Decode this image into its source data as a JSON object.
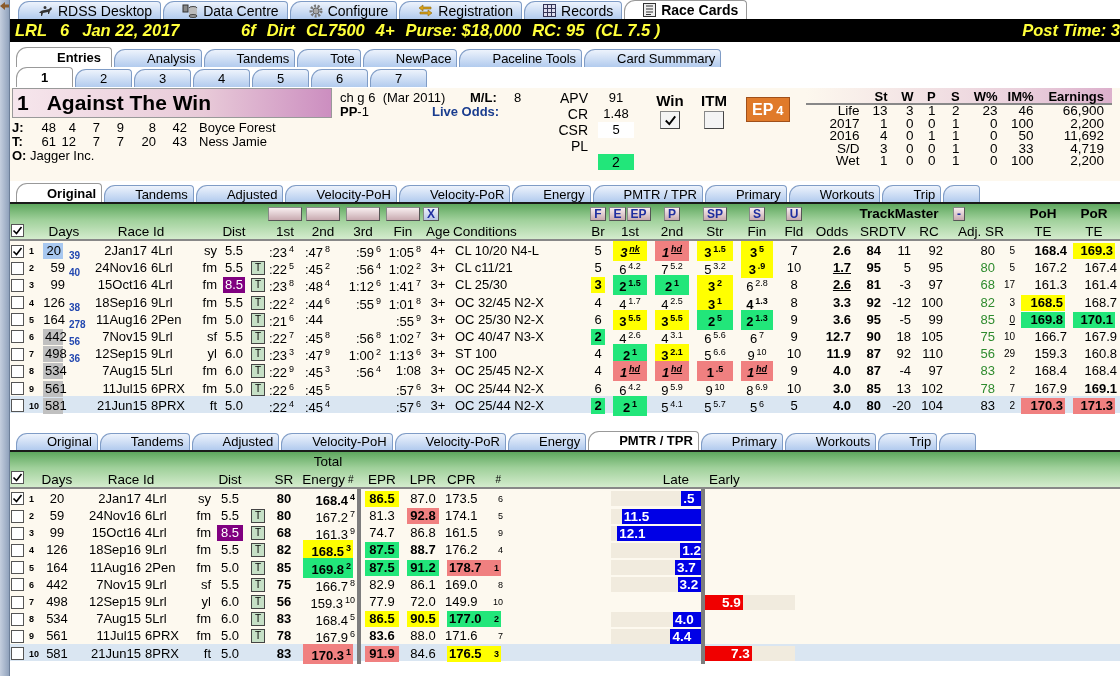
{
  "app_tabs": [
    {
      "label": "RDSS Desktop",
      "selected": false
    },
    {
      "label": "Data Centre",
      "selected": false
    },
    {
      "label": "Configure",
      "selected": false
    },
    {
      "label": "Registration",
      "selected": false
    },
    {
      "label": "Records",
      "selected": false
    },
    {
      "label": "Race Cards",
      "selected": true
    }
  ],
  "race_bar": {
    "track": "LRL",
    "race": "6",
    "date": "Jan 22, 2017",
    "details": [
      "6f",
      "Dirt",
      "CL7500",
      "4+",
      "Purse: $18,000",
      "RC: 95",
      "(CL 7.5 )"
    ],
    "post_time": "Post Time: 3"
  },
  "card_tabs": [
    {
      "label": "Entries",
      "selected": true
    },
    {
      "label": "Analysis",
      "selected": false
    },
    {
      "label": "Tandems",
      "selected": false
    },
    {
      "label": "Tote",
      "selected": false
    },
    {
      "label": "NewPace",
      "selected": false
    },
    {
      "label": "Paceline Tools",
      "selected": false
    },
    {
      "label": "Card Summmary",
      "selected": false
    }
  ],
  "horse_tabs": [
    {
      "label": "1",
      "selected": true
    },
    {
      "label": "2",
      "selected": false
    },
    {
      "label": "3",
      "selected": false
    },
    {
      "label": "4",
      "selected": false
    },
    {
      "label": "5",
      "selected": false
    },
    {
      "label": "6",
      "selected": false
    },
    {
      "label": "7",
      "selected": false
    }
  ],
  "horse": {
    "number": "1",
    "name": "Against The Win",
    "connections": [
      {
        "label": "J:",
        "stats": [
          "48",
          "4",
          "7",
          "9",
          "8",
          "42"
        ],
        "name": "Boyce Forest"
      },
      {
        "label": "T:",
        "stats": [
          "61",
          "12",
          "7",
          "7",
          "20",
          "43"
        ],
        "name": "Ness Jamie"
      },
      {
        "label": "O:",
        "name": "Jagger Inc."
      }
    ],
    "description": "ch g 6  (Mar 2011)",
    "ml_label": "M/L:",
    "ml": "8",
    "post_position": "**PP**-1",
    "live_odds_label": "Live Odds:",
    "ratings": [
      {
        "kind": "plain",
        "label": "APV",
        "value": "91"
      },
      {
        "kind": "plain",
        "label": "CR",
        "value": "1.48"
      },
      {
        "kind": "box",
        "label": "CSR",
        "value": "5"
      },
      {
        "kind": "plain",
        "label": "PL"
      }
    ],
    "pl_value": "2",
    "bets": [
      {
        "label": "Win",
        "checked": true
      },
      {
        "label": "ITM",
        "checked": false
      }
    ],
    "ep": {
      "label": "EP",
      "value": "4"
    },
    "record": {
      "columns": [
        "St",
        "W",
        "P",
        "S",
        "W%",
        "IM%",
        "Earnings"
      ],
      "rows": [
        {
          "label": "Life",
          "values": [
            "13",
            "3",
            "1",
            "2",
            "23",
            "46",
            "66,900"
          ]
        },
        {
          "label": "2017",
          "values": [
            "1",
            "0",
            "0",
            "1",
            "0",
            "100",
            "2,200"
          ]
        },
        {
          "label": "2016",
          "values": [
            "4",
            "0",
            "1",
            "1",
            "0",
            "50",
            "11,692"
          ]
        },
        {
          "label": "S/D",
          "values": [
            "3",
            "0",
            "0",
            "1",
            "0",
            "33",
            "4,719"
          ]
        },
        {
          "label": "Wet",
          "values": [
            "1",
            "0",
            "0",
            "1",
            "0",
            "100",
            "2,200"
          ]
        }
      ]
    }
  },
  "pp": {
    "tabs": [
      {
        "label": "Original",
        "selected": true
      },
      {
        "label": "Tandems",
        "selected": false
      },
      {
        "label": "Adjusted",
        "selected": false
      },
      {
        "label": "Velocity-PoH",
        "selected": false
      },
      {
        "label": "Velocity-PoR",
        "selected": false
      },
      {
        "label": "Energy",
        "selected": false
      },
      {
        "label": "PMTR / TPR",
        "selected": false
      },
      {
        "label": "Primary",
        "selected": false
      },
      {
        "label": "Workouts",
        "selected": false
      },
      {
        "label": "Trip",
        "selected": false
      },
      {
        "selected": false
      }
    ],
    "select_all": true,
    "clear_button": "X",
    "pace_buttons": [
      "F",
      "E",
      "EP",
      "P",
      "SP",
      "S",
      "U"
    ],
    "adj_button": "-",
    "headers": {
      "days": "Days",
      "race_id": "Race Id",
      "dist": "Dist",
      "c1": "1st",
      "c2": "2nd",
      "c3": "3rd",
      "fin": "Fin",
      "age": "Age",
      "conditions": "Conditions",
      "br": "Br",
      "pos1": "1st",
      "pos2": "2nd",
      "str": "Str",
      "pos_fin": "Fin",
      "field": "Fld",
      "odds": "Odds",
      "trackmaster": "TrackMaster",
      "srdtv": "SRDTV",
      "rc": "RC",
      "adj_sr": "Adj. SR",
      "poh": "PoH",
      "poh_te": "TE",
      "por": "PoR",
      "por_te": "TE"
    },
    "rows": [
      {
        "checked": true,
        "selected": false,
        "num": "1",
        "days": {
          "text": "20",
          "color": "#a8c8f0"
        },
        "layoff": "39",
        "date": "2Jan17",
        "track": "4Lrl",
        "surface": "sy",
        "dist": "5.5",
        "c1": {
          "text": ":23",
          "sup": "4"
        },
        "c2": {
          "text": ":47",
          "sup": "8"
        },
        "c3": {
          "text": ":59",
          "sup": "6"
        },
        "fin": {
          "text": "1:05",
          "sup": "8"
        },
        "age": "4+",
        "conditions": "CL 10/20 N4-L",
        "br": "5",
        "pos1": {
          "text": "3",
          "sup": "nk",
          "color": "#ffff00",
          "bold": true,
          "underline": true
        },
        "pos2": {
          "text": "1",
          "sup": "hd",
          "color": "#f08080",
          "bold": true,
          "underline": true
        },
        "str": {
          "text": "3",
          "sup": "1.5",
          "color": "#ffff00",
          "bold": true
        },
        "pos_fin": {
          "text": "3",
          "sup": "5",
          "color": "#ffff00",
          "bold": true
        },
        "field": "7",
        "odds": "2.6",
        "sr": "84",
        "dtv": "11",
        "rc": "92",
        "adj_sr": "80",
        "adj_rank": "5",
        "poh_te": {
          "text": "168.4",
          "bold": true
        },
        "por_te": {
          "text": "169.3",
          "color": "#ffff00",
          "bold": true
        }
      },
      {
        "checked": false,
        "selected": false,
        "num": "2",
        "days": "59",
        "layoff": "40",
        "date": "24Nov16",
        "track": "6Lrl",
        "surface": "fm",
        "dist": "5.5",
        "t_flag": "T",
        "c1": {
          "text": ":22",
          "sup": "5"
        },
        "c2": {
          "text": ":45",
          "sup": "2"
        },
        "c3": {
          "text": ":56",
          "sup": "4"
        },
        "fin": {
          "text": "1:02",
          "sup": "2"
        },
        "age": "3+",
        "conditions": "CL c11/21",
        "br": "5",
        "pos1": {
          "text": "6",
          "sup": "4.2"
        },
        "pos2": {
          "text": "7",
          "sup": "5.2"
        },
        "str": {
          "text": "5",
          "sup": "3.2"
        },
        "pos_fin": {
          "text": "3",
          "sup": ".9",
          "color": "#ffff00",
          "bold": true
        },
        "field": "10",
        "odds": {
          "text": "1.7",
          "underline": true
        },
        "sr": "95",
        "dtv": "5",
        "rc": "95",
        "adj_sr": {
          "text": "80",
          "color": "#2e8b2e"
        },
        "adj_rank": "5",
        "poh_te": "167.2",
        "por_te": "167.4"
      },
      {
        "checked": false,
        "selected": false,
        "num": "3",
        "days": "99",
        "date": "15Oct16",
        "track": "4Lrl",
        "surface": "fm",
        "dist": {
          "text": "8.5",
          "color": "#800080"
        },
        "t_flag": "T",
        "c1": {
          "text": ":23",
          "sup": "8"
        },
        "c2": {
          "text": ":48",
          "sup": "4"
        },
        "c3": {
          "text": "1:12",
          "sup": "6"
        },
        "fin": {
          "text": "1:41",
          "sup": "7"
        },
        "age": "3+",
        "conditions": "CL 25/30",
        "br": {
          "text": "3",
          "color": "#ffff00",
          "bold": true
        },
        "pos1": {
          "text": "2",
          "sup": "1.5",
          "color": "#22e67a",
          "bold": true
        },
        "pos2": {
          "text": "2",
          "sup": "1",
          "color": "#22e67a",
          "bold": true
        },
        "str": {
          "text": "3",
          "sup": "2",
          "color": "#ffff00",
          "bold": true
        },
        "pos_fin": {
          "text": "6",
          "sup": "2.8"
        },
        "field": "8",
        "odds": {
          "text": "2.6",
          "underline": true
        },
        "sr": "81",
        "dtv": "-3",
        "rc": "97",
        "adj_sr": {
          "text": "68",
          "color": "#2e8b2e"
        },
        "adj_rank": "17",
        "poh_te": "161.3",
        "por_te": "161.4"
      },
      {
        "checked": false,
        "selected": false,
        "num": "4",
        "days": "126",
        "layoff": "38",
        "date": "18Sep16",
        "track": "9Lrl",
        "surface": "fm",
        "dist": "5.5",
        "t_flag": "T",
        "c1": {
          "text": ":22",
          "sup": "2"
        },
        "c2": {
          "text": ":44",
          "sup": "6"
        },
        "c3": {
          "text": ":55",
          "sup": "9"
        },
        "fin": {
          "text": "1:01",
          "sup": "8"
        },
        "age": "3+",
        "conditions": "OC 32/45 N2-X",
        "br": "4",
        "pos1": {
          "text": "4",
          "sup": "1.7"
        },
        "pos2": {
          "text": "4",
          "sup": "2.5"
        },
        "str": {
          "text": "3",
          "sup": "1",
          "color": "#ffff00",
          "bold": true
        },
        "pos_fin": {
          "text": "4",
          "sup": "1.3",
          "bold": true
        },
        "field": "8",
        "odds": "3.3",
        "sr": "92",
        "dtv": "-12",
        "rc": "100",
        "adj_sr": {
          "text": "82",
          "color": "#2e8b2e"
        },
        "adj_rank": "3",
        "poh_te": {
          "text": "168.5",
          "color": "#ffff00",
          "bold": true
        },
        "por_te": "168.7"
      },
      {
        "checked": false,
        "selected": false,
        "num": "5",
        "days": "164",
        "layoff": "278",
        "date": "11Aug16",
        "track": "2Pen",
        "surface": "fm",
        "dist": "5.0",
        "t_flag": "T",
        "c1": {
          "text": ":21",
          "sup": "6"
        },
        "c2": ":44",
        "fin": {
          "text": ":55",
          "sup": "9"
        },
        "age": "3+",
        "conditions": "OC 25/30 N2-X",
        "br": "6",
        "pos1": {
          "text": "3",
          "sup": "5.5",
          "color": "#ffff00",
          "bold": true
        },
        "pos2": {
          "text": "3",
          "sup": "5.5",
          "color": "#ffff00",
          "bold": true
        },
        "str": {
          "text": "2",
          "sup": "5",
          "color": "#22e67a",
          "bold": true
        },
        "pos_fin": {
          "text": "2",
          "sup": "1.3",
          "color": "#22e67a",
          "bold": true
        },
        "field": "9",
        "odds": "3.6",
        "sr": "95",
        "dtv": "-5",
        "rc": "99",
        "adj_sr": {
          "text": "85",
          "color": "#2e8b2e"
        },
        "adj_rank": {
          "text": "0",
          "underline": true
        },
        "poh_te": {
          "text": "169.8",
          "color": "#22e67a",
          "bold": true
        },
        "por_te": {
          "text": "170.1",
          "color": "#22e67a",
          "bold": true
        }
      },
      {
        "checked": false,
        "selected": false,
        "num": "6",
        "days": {
          "text": "442",
          "color": "#c0c0c0"
        },
        "layoff": "56",
        "date": "7Nov15",
        "track": "9Lrl",
        "surface": "sf",
        "dist": "5.5",
        "t_flag": "T",
        "c1": {
          "text": ":22",
          "sup": "7"
        },
        "c2": {
          "text": ":45",
          "sup": "8"
        },
        "c3": {
          "text": ":56",
          "sup": "8"
        },
        "fin": {
          "text": "1:02",
          "sup": "7"
        },
        "age": "3+",
        "conditions": "OC 40/47 N3-X",
        "br": {
          "text": "2",
          "color": "#22e67a",
          "bold": true
        },
        "pos1": {
          "text": "4",
          "sup": "2.6"
        },
        "pos2": {
          "text": "4",
          "sup": "3.1"
        },
        "str": {
          "text": "6",
          "sup": "5.6"
        },
        "pos_fin": {
          "text": "6",
          "sup": "7"
        },
        "field": "9",
        "odds": "12.7",
        "sr": "90",
        "dtv": "18",
        "rc": "105",
        "adj_sr": {
          "text": "75",
          "color": "#2e8b2e"
        },
        "adj_rank": "10",
        "poh_te": "166.7",
        "por_te": "167.9"
      },
      {
        "checked": false,
        "selected": false,
        "num": "7",
        "days": {
          "text": "498",
          "color": "#c0c0c0"
        },
        "layoff": "36",
        "date": "12Sep15",
        "track": "9Lrl",
        "surface": "yl",
        "dist": "6.0",
        "t_flag": "T",
        "c1": {
          "text": ":23",
          "sup": "3"
        },
        "c2": {
          "text": ":47",
          "sup": "9"
        },
        "c3": {
          "text": "1:00",
          "sup": "2"
        },
        "fin": {
          "text": "1:13",
          "sup": "6"
        },
        "age": "3+",
        "conditions": "ST 100",
        "br": "4",
        "pos1": {
          "text": "2",
          "sup": "1",
          "color": "#22e67a",
          "bold": true
        },
        "pos2": {
          "text": "3",
          "sup": "2.1",
          "color": "#ffff00",
          "bold": true
        },
        "str": {
          "text": "5",
          "sup": "6.6"
        },
        "pos_fin": {
          "text": "9",
          "sup": "10"
        },
        "field": "10",
        "odds": "11.9",
        "sr": "87",
        "dtv": "92",
        "rc": "110",
        "adj_sr": {
          "text": "56",
          "color": "#2e8b2e"
        },
        "adj_rank": "29",
        "poh_te": "159.3",
        "por_te": "160.8"
      },
      {
        "checked": false,
        "selected": false,
        "num": "8",
        "days": {
          "text": "534",
          "color": "#c0c0c0"
        },
        "date": "7Aug15",
        "track": "5Lrl",
        "surface": "fm",
        "dist": "6.0",
        "t_flag": "T",
        "c1": {
          "text": ":22",
          "sup": "9"
        },
        "c2": {
          "text": ":45",
          "sup": "3"
        },
        "c3": {
          "text": ":56",
          "sup": "4"
        },
        "fin": "1:08",
        "age": "3+",
        "conditions": "OC 25/45 N2-X",
        "br": "4",
        "pos1": {
          "text": "1",
          "sup": "hd",
          "color": "#f08080",
          "bold": true,
          "underline": true
        },
        "pos2": {
          "text": "1",
          "sup": "hd",
          "color": "#f08080",
          "bold": true,
          "underline": true
        },
        "str": {
          "text": "1",
          "sup": ".5",
          "color": "#f08080",
          "bold": true
        },
        "pos_fin": {
          "text": "1",
          "sup": "hd",
          "color": "#f08080",
          "bold": true,
          "underline": true
        },
        "field": "9",
        "odds": "4.0",
        "sr": "87",
        "dtv": "-4",
        "rc": "97",
        "adj_sr": {
          "text": "83",
          "color": "#2e8b2e"
        },
        "adj_rank": "2",
        "poh_te": "168.4",
        "por_te": "168.4"
      },
      {
        "checked": false,
        "selected": false,
        "num": "9",
        "days": {
          "text": "561",
          "color": "#c0c0c0"
        },
        "date": "11Jul15",
        "track": "6PRX",
        "surface": "fm",
        "dist": "5.0",
        "t_flag": "T",
        "c1": {
          "text": ":22",
          "sup": "6"
        },
        "c2": {
          "text": ":45",
          "sup": "5"
        },
        "fin": {
          "text": ":57",
          "sup": "6"
        },
        "age": "3+",
        "conditions": "OC 25/44 N2-X",
        "br": "6",
        "pos1": {
          "text": "6",
          "sup": "4.2"
        },
        "pos2": {
          "text": "9",
          "sup": "5.9"
        },
        "str": {
          "text": "9",
          "sup": "10"
        },
        "pos_fin": {
          "text": "8",
          "sup": "6.9"
        },
        "field": "10",
        "odds": "3.0",
        "sr": "85",
        "dtv": "13",
        "rc": "102",
        "adj_sr": {
          "text": "78",
          "color": "#2e8b2e"
        },
        "adj_rank": "7",
        "poh_te": "167.9",
        "por_te": {
          "text": "169.1",
          "bold": true
        }
      },
      {
        "checked": false,
        "selected": true,
        "num": "10",
        "days": {
          "text": "581",
          "color": "#c0c0c0"
        },
        "date": "21Jun15",
        "track": "8PRX",
        "surface": "ft",
        "dist": "5.0",
        "c1": {
          "text": ":22",
          "sup": "4"
        },
        "c2": {
          "text": ":45",
          "sup": "4"
        },
        "fin": {
          "text": ":57",
          "sup": "6"
        },
        "age": "3+",
        "conditions": "OC 25/44 N2-X",
        "br": {
          "text": "2",
          "color": "#22e67a",
          "bold": true
        },
        "pos1": {
          "text": "2",
          "sup": "1",
          "color": "#22e67a",
          "bold": true
        },
        "pos2": {
          "text": "5",
          "sup": "4.1"
        },
        "str": {
          "text": "5",
          "sup": "5.7"
        },
        "pos_fin": {
          "text": "5",
          "sup": "6"
        },
        "field": "5",
        "odds": "4.0",
        "sr": "80",
        "dtv": "-20",
        "rc": "104",
        "adj_sr": "83",
        "adj_rank": "2",
        "poh_te": {
          "text": "170.3",
          "color": "#f08080",
          "bold": true
        },
        "por_te": {
          "text": "171.3",
          "color": "#f08080",
          "bold": true
        }
      }
    ]
  },
  "energy": {
    "tabs": [
      {
        "label": "Original",
        "selected": false
      },
      {
        "label": "Tandems",
        "selected": false
      },
      {
        "label": "Adjusted",
        "selected": false
      },
      {
        "label": "Velocity-PoH",
        "selected": false
      },
      {
        "label": "Velocity-PoR",
        "selected": false
      },
      {
        "label": "Energy",
        "selected": false
      },
      {
        "label": "PMTR / TPR",
        "selected": true
      },
      {
        "label": "Primary",
        "selected": false
      },
      {
        "label": "Workouts",
        "selected": false
      },
      {
        "label": "Trip",
        "selected": false
      },
      {
        "selected": false
      }
    ],
    "select_all": true,
    "headers": {
      "days": "Days",
      "race_id": "Race Id",
      "dist": "Dist",
      "sr": "SR",
      "total": "Total",
      "energy": "Energy",
      "te_rank": "#",
      "epr": "EPR",
      "lpr": "LPR",
      "cpr": "CPR",
      "cpr_rank": "#",
      "late": "Late",
      "early": "Early"
    },
    "rows": [
      {
        "checked": true,
        "selected": false,
        "num": "1",
        "days": "20",
        "date": "2Jan17",
        "track": "4Lrl",
        "surface": "sy",
        "dist": "5.5",
        "sr": "80",
        "total_energy": {
          "text": "168.4",
          "sup": "4",
          "bold": true
        },
        "epr": {
          "text": "86.5",
          "color": "#ffff00",
          "bold": true
        },
        "lpr": "87.0",
        "cpr": {
          "text": "173.5",
          "sup": "6"
        },
        "bar": {
          "kind": "late",
          "text": ".5",
          "level": 0.22
        }
      },
      {
        "checked": false,
        "selected": false,
        "num": "2",
        "days": "59",
        "date": "24Nov16",
        "track": "6Lrl",
        "surface": "fm",
        "dist": "5.5",
        "t_flag": "T",
        "sr": "80",
        "total_energy": {
          "text": "167.2",
          "sup": "7"
        },
        "epr": "81.3",
        "lpr": {
          "text": "92.8",
          "color": "#f08080",
          "bold": true
        },
        "cpr": {
          "text": "174.1",
          "sup": "5"
        },
        "bar": {
          "kind": "late",
          "text": "11.5",
          "level": 0.88
        }
      },
      {
        "checked": false,
        "selected": false,
        "num": "3",
        "days": "99",
        "date": "15Oct16",
        "track": "4Lrl",
        "surface": "fm",
        "dist": {
          "text": "8.5",
          "color": "#800080"
        },
        "t_flag": "T",
        "sr": "68",
        "total_energy": {
          "text": "161.3",
          "sup": "9"
        },
        "epr": "74.7",
        "lpr": "86.8",
        "cpr": {
          "text": "161.5",
          "sup": "9"
        },
        "bar": {
          "kind": "late",
          "text": "12.1",
          "level": 0.93
        }
      },
      {
        "checked": false,
        "selected": false,
        "num": "4",
        "days": "126",
        "date": "18Sep16",
        "track": "9Lrl",
        "surface": "fm",
        "dist": "5.5",
        "t_flag": "T",
        "sr": "82",
        "total_energy": {
          "text": "168.5",
          "sup": "3",
          "color": "#ffff00",
          "bold": true
        },
        "epr": {
          "text": "87.5",
          "color": "#22e67a",
          "bold": true
        },
        "lpr": {
          "text": "88.7",
          "bold": true
        },
        "cpr": {
          "text": "176.2",
          "sup": "4"
        },
        "bar": {
          "kind": "late",
          "text": "1.2",
          "level": 0.23
        }
      },
      {
        "checked": false,
        "selected": false,
        "num": "5",
        "days": "164",
        "date": "11Aug16",
        "track": "2Pen",
        "surface": "fm",
        "dist": "5.0",
        "t_flag": "T",
        "sr": "85",
        "total_energy": {
          "text": "169.8",
          "sup": "2",
          "color": "#22e67a",
          "bold": true
        },
        "epr": {
          "text": "87.5",
          "color": "#22e67a",
          "bold": true
        },
        "lpr": {
          "text": "91.2",
          "color": "#22e67a",
          "bold": true
        },
        "cpr": {
          "text": "178.7",
          "sup": "1",
          "color": "#f08080",
          "bold": true
        },
        "bar": {
          "kind": "late",
          "text": "3.7",
          "level": 0.29
        }
      },
      {
        "checked": false,
        "selected": false,
        "num": "6",
        "days": "442",
        "date": "7Nov15",
        "track": "9Lrl",
        "surface": "sf",
        "dist": "5.5",
        "t_flag": "T",
        "sr": "75",
        "total_energy": {
          "text": "166.7",
          "sup": "8"
        },
        "epr": "82.9",
        "lpr": "86.1",
        "cpr": {
          "text": "169.0",
          "sup": "8"
        },
        "bar": {
          "kind": "late",
          "text": "3.2",
          "level": 0.26
        }
      },
      {
        "checked": false,
        "selected": false,
        "num": "7",
        "days": "498",
        "date": "12Sep15",
        "track": "9Lrl",
        "surface": "yl",
        "dist": "6.0",
        "t_flag": "T",
        "sr": "56",
        "total_energy": {
          "text": "159.3",
          "sup": "10"
        },
        "epr": "77.9",
        "lpr": "72.0",
        "cpr": {
          "text": "149.9",
          "sup": "10"
        },
        "bar": {
          "kind": "early",
          "text": "5.9",
          "level": 0.42
        }
      },
      {
        "checked": false,
        "selected": false,
        "num": "8",
        "days": "534",
        "date": "7Aug15",
        "track": "5Lrl",
        "surface": "fm",
        "dist": "6.0",
        "t_flag": "T",
        "sr": "83",
        "total_energy": {
          "text": "168.4",
          "sup": "5"
        },
        "epr": {
          "text": "86.5",
          "color": "#ffff00",
          "bold": true
        },
        "lpr": {
          "text": "90.5",
          "color": "#ffff00",
          "bold": true
        },
        "cpr": {
          "text": "177.0",
          "sup": "2",
          "color": "#22e67a",
          "bold": true
        },
        "bar": {
          "kind": "late",
          "text": "4.0",
          "level": 0.31
        }
      },
      {
        "checked": false,
        "selected": false,
        "num": "9",
        "days": "561",
        "date": "11Jul15",
        "track": "6PRX",
        "surface": "fm",
        "dist": "5.0",
        "t_flag": "T",
        "sr": "78",
        "total_energy": {
          "text": "167.9",
          "sup": "6"
        },
        "epr": {
          "text": "83.6",
          "bold": true
        },
        "lpr": "88.0",
        "cpr": {
          "text": "171.6",
          "sup": "7"
        },
        "bar": {
          "kind": "late",
          "text": "4.4",
          "level": 0.34
        }
      },
      {
        "checked": false,
        "selected": true,
        "num": "10",
        "days": "581",
        "date": "21Jun15",
        "track": "8PRX",
        "surface": "ft",
        "dist": "5.0",
        "sr": "83",
        "total_energy": {
          "text": "170.3",
          "sup": "1",
          "color": "#f08080",
          "bold": true
        },
        "epr": {
          "text": "91.9",
          "color": "#f08080",
          "bold": true
        },
        "lpr": "84.6",
        "cpr": {
          "text": "176.5",
          "sup": "3",
          "color": "#ffff00",
          "bold": true
        },
        "bar": {
          "kind": "early",
          "text": "7.3",
          "level": 0.52
        }
      }
    ]
  }
}
